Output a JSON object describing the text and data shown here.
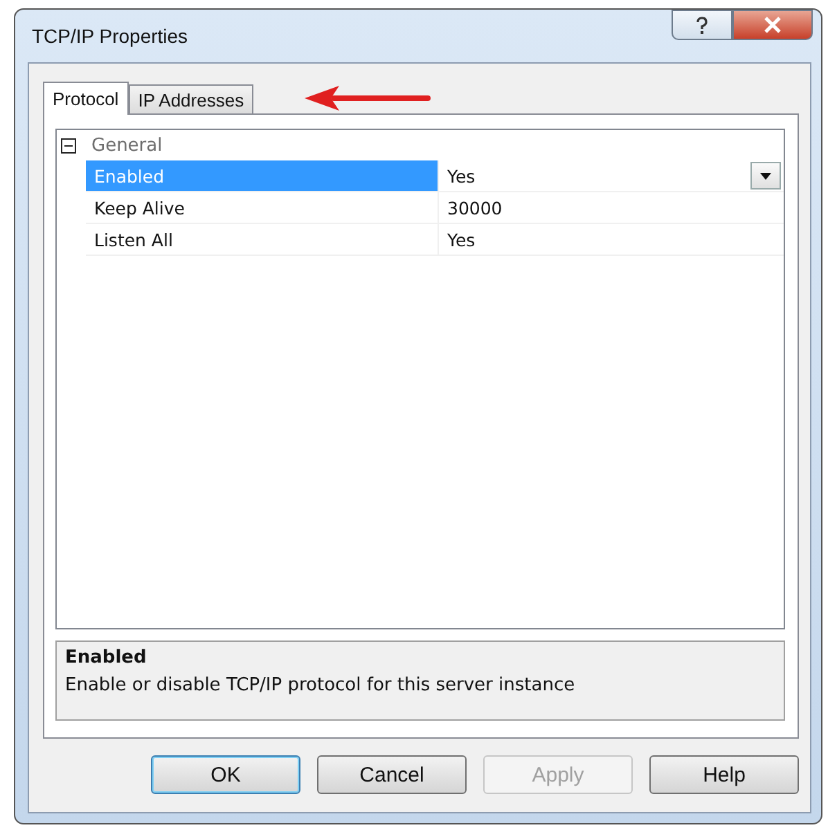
{
  "window": {
    "title": "TCP/IP Properties"
  },
  "tabs": [
    {
      "label": "Protocol",
      "selected": true
    },
    {
      "label": "IP Addresses",
      "selected": false
    }
  ],
  "grid": {
    "category": {
      "label": "General",
      "expanded": true
    },
    "rows": [
      {
        "name": "Enabled",
        "value": "Yes",
        "selected": true
      },
      {
        "name": "Keep Alive",
        "value": "30000",
        "selected": false
      },
      {
        "name": "Listen All",
        "value": "Yes",
        "selected": false
      }
    ]
  },
  "description": {
    "title": "Enabled",
    "text": "Enable or disable TCP/IP protocol for this server instance"
  },
  "buttons": [
    {
      "label": "OK",
      "default": true,
      "disabled": false
    },
    {
      "label": "Cancel",
      "default": false,
      "disabled": false
    },
    {
      "label": "Apply",
      "default": false,
      "disabled": true
    },
    {
      "label": "Help",
      "default": false,
      "disabled": false
    }
  ]
}
